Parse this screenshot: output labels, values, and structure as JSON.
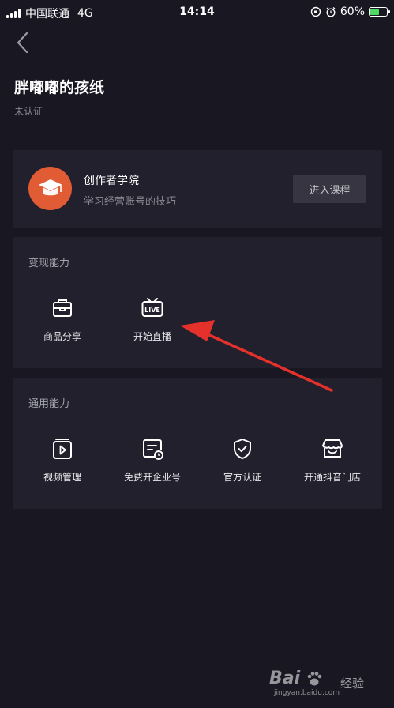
{
  "status_bar": {
    "carrier": "中国联通",
    "network": "4G",
    "time": "14:14",
    "battery": "60%",
    "battery_level": 0.6
  },
  "header": {
    "title": "胖嘟嘟的孩纸",
    "subtitle": "未认证"
  },
  "academy": {
    "title": "创作者学院",
    "description": "学习经营账号的技巧",
    "button_label": "进入课程",
    "accent_color": "#e15b35"
  },
  "monetization": {
    "title": "变现能力",
    "items": [
      {
        "label": "商品分享",
        "icon": "shopping-bag-icon"
      },
      {
        "label": "开始直播",
        "icon": "live-tv-icon"
      }
    ]
  },
  "general": {
    "title": "通用能力",
    "items": [
      {
        "label": "视频管理",
        "icon": "video-folder-icon"
      },
      {
        "label": "免费开企业号",
        "icon": "enterprise-card-icon"
      },
      {
        "label": "官方认证",
        "icon": "shield-check-icon"
      },
      {
        "label": "开通抖音门店",
        "icon": "storefront-icon"
      }
    ]
  },
  "annotation": {
    "arrow_color": "#e5312b",
    "points_to": "开始直播"
  },
  "watermark": {
    "brand": "Bai",
    "suffix": "经验",
    "url": "jingyan.baidu.com"
  }
}
